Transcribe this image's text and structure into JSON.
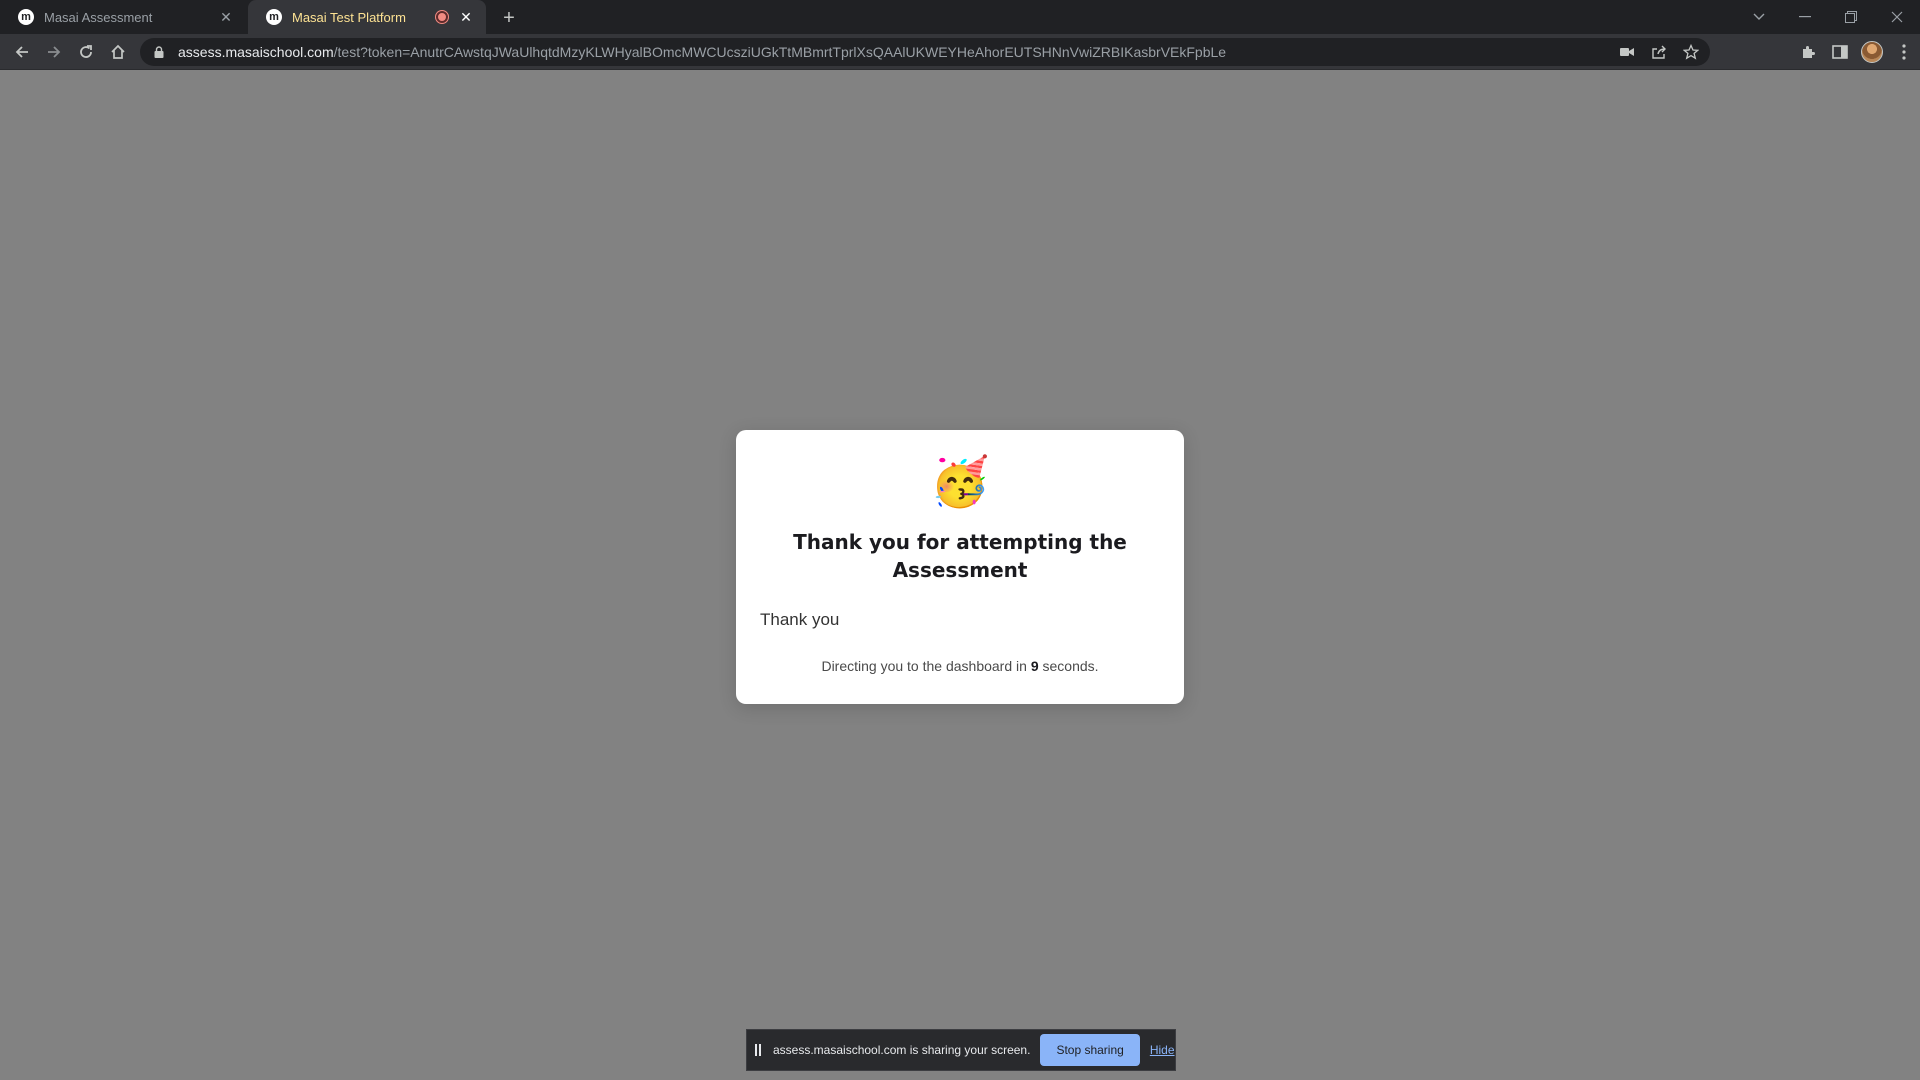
{
  "tabs": [
    {
      "title": "Masai Assessment",
      "favicon": "m",
      "active": false
    },
    {
      "title": "Masai Test Platform",
      "favicon": "m",
      "active": true,
      "recording": true
    }
  ],
  "toolbar": {
    "url_host": "assess.masaischool.com",
    "url_path": "/test?token=AnutrCAwstqJWaUlhqtdMzyKLWHyalBOmcMWCUcsziUGkTtMBmrtTprlXsQAAlUKWEYHeAhorEUTSHNnVwiZRBIKasbrVEkFpbLe"
  },
  "modal": {
    "emoji": "🥳",
    "title": "Thank you for attempting the Assessment",
    "message": "Thank you",
    "redirect_prefix": "Directing you to the dashboard in",
    "redirect_seconds": "9",
    "redirect_suffix": "seconds."
  },
  "sharebar": {
    "text": "assess.masaischool.com is sharing your screen.",
    "stop_label": "Stop sharing",
    "hide_label": "Hide"
  },
  "colors": {
    "page_bg": "#828282",
    "active_tab_text": "#fde293",
    "stop_button": "#8ab4f8"
  }
}
